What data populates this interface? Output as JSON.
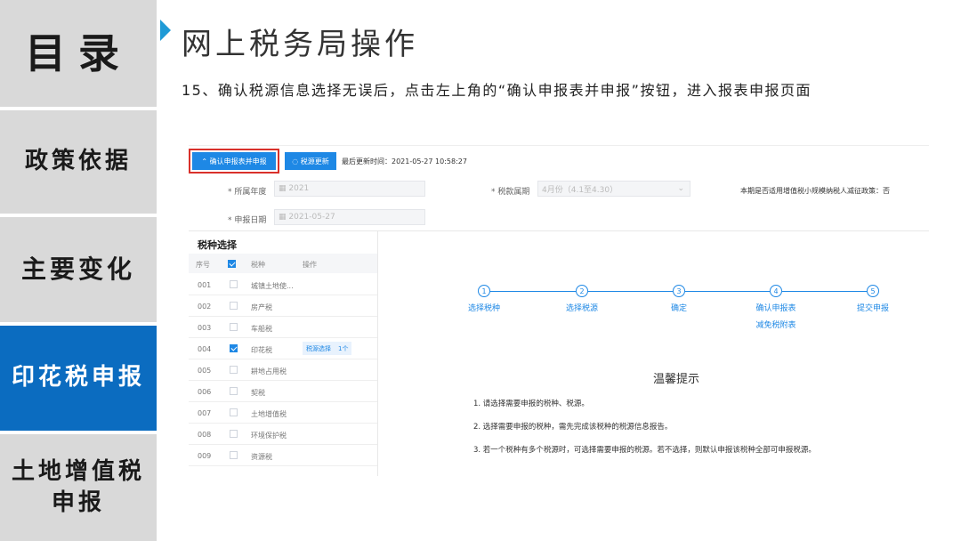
{
  "nav": {
    "items": [
      {
        "label": "目录",
        "active": false
      },
      {
        "label": "政策依据",
        "active": false
      },
      {
        "label": "主要变化",
        "active": false
      },
      {
        "label": "印花税申报",
        "active": true
      },
      {
        "label": "土地增值税申报",
        "active": false
      }
    ]
  },
  "slide": {
    "title": "网上税务局操作",
    "instruction": "15、确认税源信息选择无误后，点击左上角的“确认申报表并申报”按钮，进入报表申报页面"
  },
  "app": {
    "toolbar": {
      "confirm_label": "⌃ 确认申报表并申报",
      "refresh_label": "◌ 税源更新",
      "update_time": "最后更新时间：2021-05-27 10:58:27"
    },
    "form": {
      "year_label": "* 所属年度",
      "year_value": "▦ 2021",
      "period_label": "* 税款属期",
      "period_value": "4月份（4.1至4.30）",
      "date_label": "* 申报日期",
      "date_value": "▦ 2021-05-27",
      "right_note": "本期是否适用增值税小规模纳税人减征政策：否"
    },
    "tax_panel": {
      "title": "税种选择",
      "columns": [
        "序号",
        "税种",
        "操作"
      ],
      "rows": [
        {
          "no": "001",
          "name": "城镇土地使...",
          "checked": false
        },
        {
          "no": "002",
          "name": "房产税",
          "checked": false
        },
        {
          "no": "003",
          "name": "车船税",
          "checked": false
        },
        {
          "no": "004",
          "name": "印花税",
          "checked": true,
          "action": "税源选择",
          "count": "1个"
        },
        {
          "no": "005",
          "name": "耕地占用税",
          "checked": false
        },
        {
          "no": "006",
          "name": "契税",
          "checked": false
        },
        {
          "no": "007",
          "name": "土地增值税",
          "checked": false
        },
        {
          "no": "008",
          "name": "环境保护税",
          "checked": false
        },
        {
          "no": "009",
          "name": "资源税",
          "checked": false
        }
      ]
    },
    "steps": [
      {
        "num": "1",
        "label": "选择税种"
      },
      {
        "num": "2",
        "label": "选择税源"
      },
      {
        "num": "3",
        "label": "确定"
      },
      {
        "num": "4",
        "label": "确认申报表"
      },
      {
        "num": "5",
        "label": "提交申报"
      }
    ],
    "step4_sub": "减免税附表",
    "tips": {
      "title": "温馨提示",
      "items": [
        "1. 请选择需要申报的税种、税源。",
        "2. 选择需要申报的税种，需先完成该税种的税源信息报告。",
        "3. 若一个税种有多个税源时，可选择需要申报的税源。若不选择，则默认申报该税种全部可申报税源。"
      ]
    }
  },
  "colors": {
    "accent": "#1e88e5",
    "nav_active": "#0b6cc0",
    "nav_bg": "#d9d9d9",
    "highlight": "#d9312b"
  }
}
